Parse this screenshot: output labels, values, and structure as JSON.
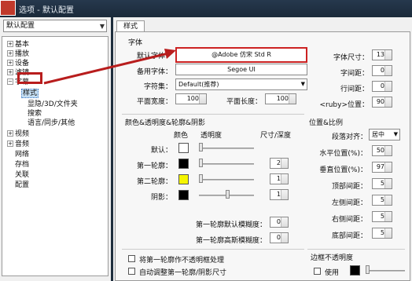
{
  "window": {
    "title": "选项 - 默认配置"
  },
  "profile": {
    "selected": "默认配置"
  },
  "tree": [
    {
      "label": "基本",
      "exp": "+"
    },
    {
      "label": "播放",
      "exp": "+"
    },
    {
      "label": "设备",
      "exp": "+"
    },
    {
      "label": "滤镜",
      "exp": "+"
    },
    {
      "label": "字幕",
      "exp": "−"
    },
    {
      "label": "样式",
      "exp": ""
    },
    {
      "label": "显隐/3D/文件夹",
      "exp": ""
    },
    {
      "label": "搜索",
      "exp": ""
    },
    {
      "label": "语言/同步/其他",
      "exp": ""
    },
    {
      "label": "视频",
      "exp": "+"
    },
    {
      "label": "音频",
      "exp": "+"
    },
    {
      "label": "网络",
      "exp": ""
    },
    {
      "label": "存档",
      "exp": ""
    },
    {
      "label": "关联",
      "exp": ""
    },
    {
      "label": "配置",
      "exp": ""
    }
  ],
  "tab": {
    "label": "样式"
  },
  "font": {
    "group_title": "字体",
    "default_font_label": "默认字体：",
    "default_font_value": "@Adobe 仿宋 Std R",
    "fallback_font_label": "备用字体：",
    "fallback_font_value": "Segoe UI",
    "charset_label": "字符集：",
    "charset_value": "Default(推荐)",
    "h_width_label": "平面宽度：",
    "h_width_value": "100",
    "h_length_label": "平面长度：",
    "h_length_value": "100",
    "size_label": "字体尺寸：",
    "size_value": "13",
    "char_spacing_label": "字间距：",
    "char_spacing_value": "0",
    "line_spacing_label": "行间距：",
    "line_spacing_value": "0",
    "ruby_label": "<ruby>位置：",
    "ruby_value": "90"
  },
  "colors": {
    "group_title": "颜色&透明度&轮廓&阴影",
    "col_color": "颜色",
    "col_opacity": "透明度",
    "col_size": "尺寸/深度",
    "rows": [
      {
        "label": "默认：",
        "color": "#ffffff",
        "size": ""
      },
      {
        "label": "第一轮廓：",
        "color": "#000000",
        "size": "2"
      },
      {
        "label": "第二轮廓：",
        "color": "#f5f500",
        "size": "1"
      },
      {
        "label": "阴影：",
        "color": "#000000",
        "size": "1"
      }
    ],
    "blur1_label": "第一轮廓默认模糊度：",
    "blur1_value": "0",
    "blur2_label": "第一轮廓高斯模糊度：",
    "blur2_value": "0"
  },
  "checkboxes": [
    {
      "label": "将第一轮廓作不透明框处理"
    },
    {
      "label": "自动调整第一轮廓/阴影尺寸"
    }
  ],
  "position": {
    "group_title": "位置&比例",
    "align_label": "段落对齐：",
    "align_value": "居中",
    "hpos_label": "水平位置(%)：",
    "hpos_value": "50",
    "vpos_label": "垂直位置(%)：",
    "vpos_value": "97",
    "top_label": "顶部间距：",
    "top_value": "5",
    "left_label": "左侧间距：",
    "left_value": "5",
    "right_label": "右侧间距：",
    "right_value": "5",
    "bottom_label": "底部间距：",
    "bottom_value": "5"
  },
  "border": {
    "group_title": "边框不透明度",
    "use_label": "使用"
  }
}
